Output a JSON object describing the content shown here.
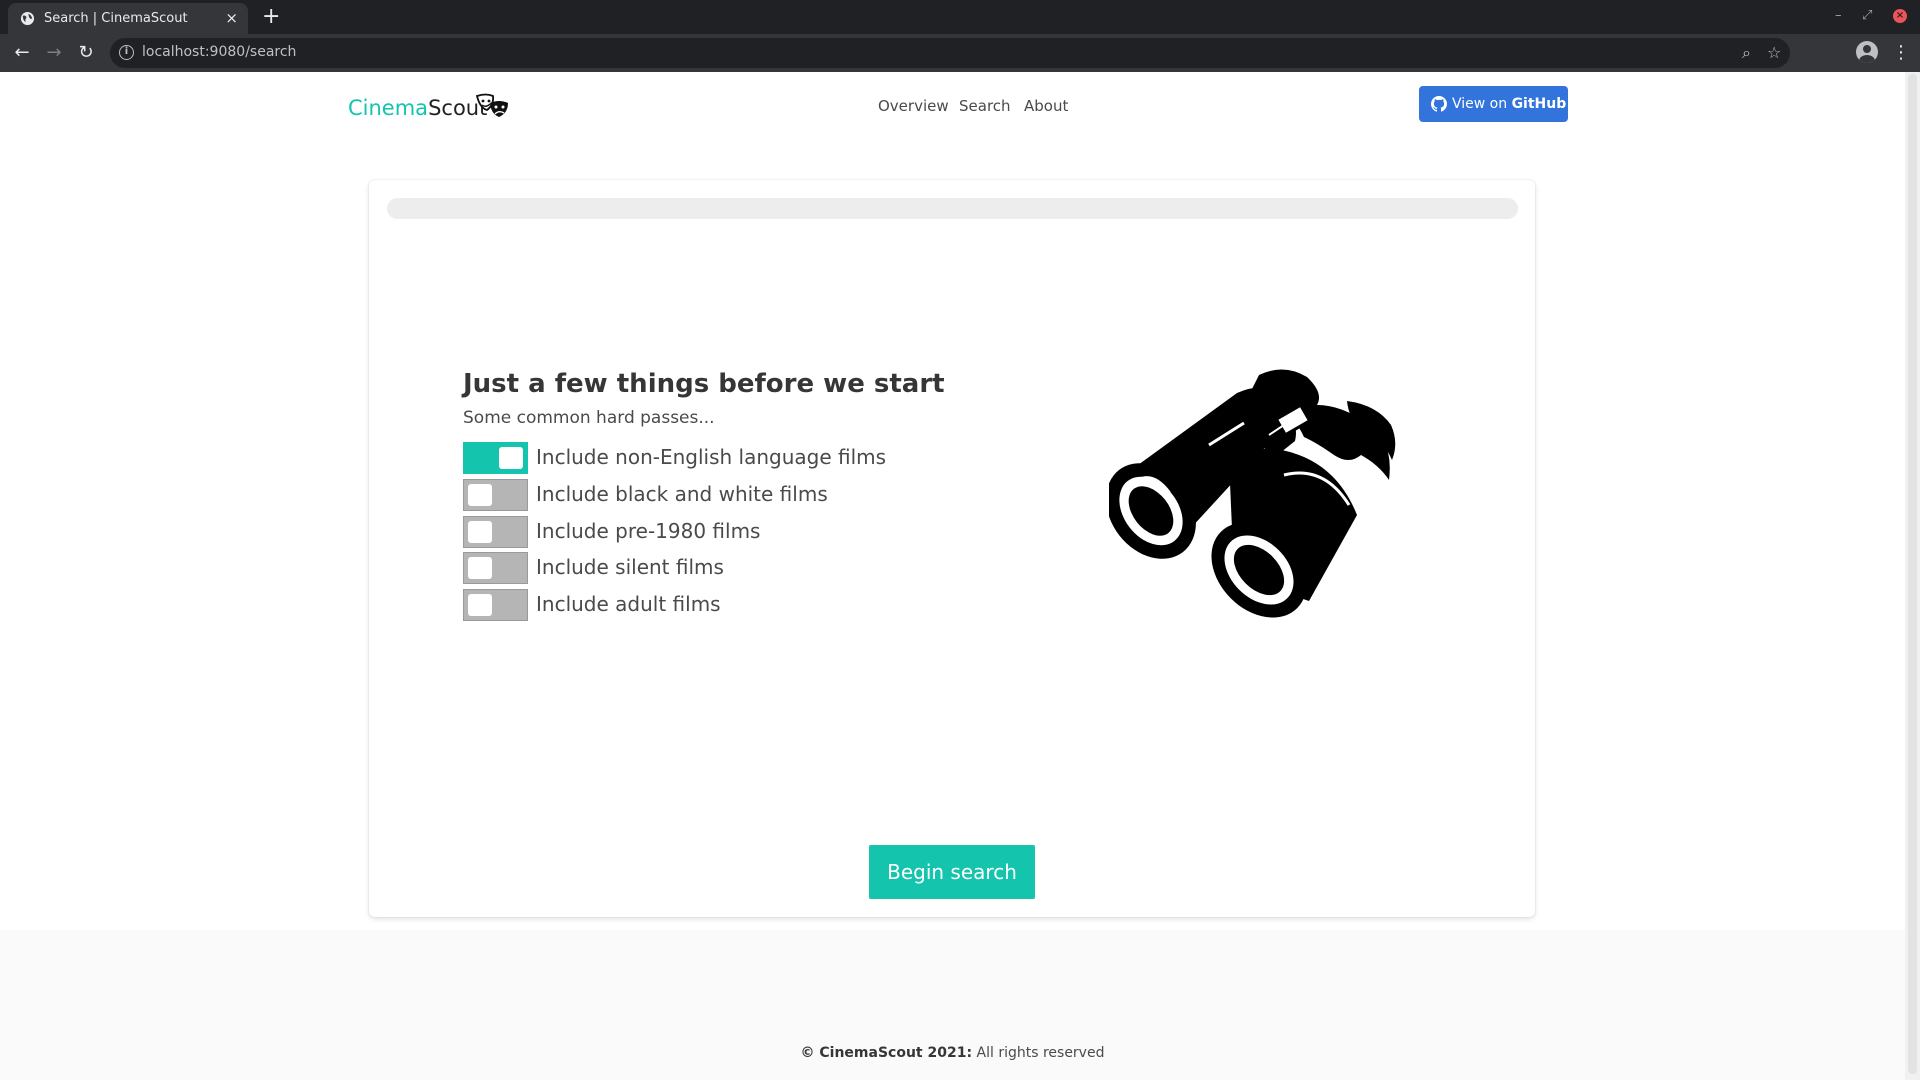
{
  "browser": {
    "tab_title": "Search | CinemaScout",
    "url": "localhost:9080/search",
    "tab_close": "×",
    "new_tab": "+",
    "back": "←",
    "forward": "→",
    "reload": "↻",
    "info": "i",
    "zoom_icon": "⌕",
    "star_icon": "☆",
    "menu": "⋮",
    "minimize": "–",
    "restore": "⤢",
    "close": "×"
  },
  "header": {
    "brand_part1": "Cinema",
    "brand_part2": "Scout",
    "nav": [
      {
        "label": "Overview"
      },
      {
        "label": "Search"
      },
      {
        "label": "About"
      }
    ],
    "github_prefix": "View on ",
    "github_bold": "GitHub"
  },
  "main": {
    "progress_percent": 0,
    "heading": "Just a few things before we start",
    "subheading": "Some common hard passes...",
    "options": [
      {
        "label": "Include non-English language films",
        "checked": true
      },
      {
        "label": "Include black and white films",
        "checked": false
      },
      {
        "label": "Include pre-1980 films",
        "checked": false
      },
      {
        "label": "Include silent films",
        "checked": false
      },
      {
        "label": "Include adult films",
        "checked": false
      }
    ],
    "begin_button": "Begin search"
  },
  "footer": {
    "bold": "© CinemaScout 2021:",
    "text": " All rights reserved"
  },
  "colors": {
    "accent": "#14c4ad",
    "github_button": "#3273dc",
    "switch_off": "#b5b5b5"
  }
}
